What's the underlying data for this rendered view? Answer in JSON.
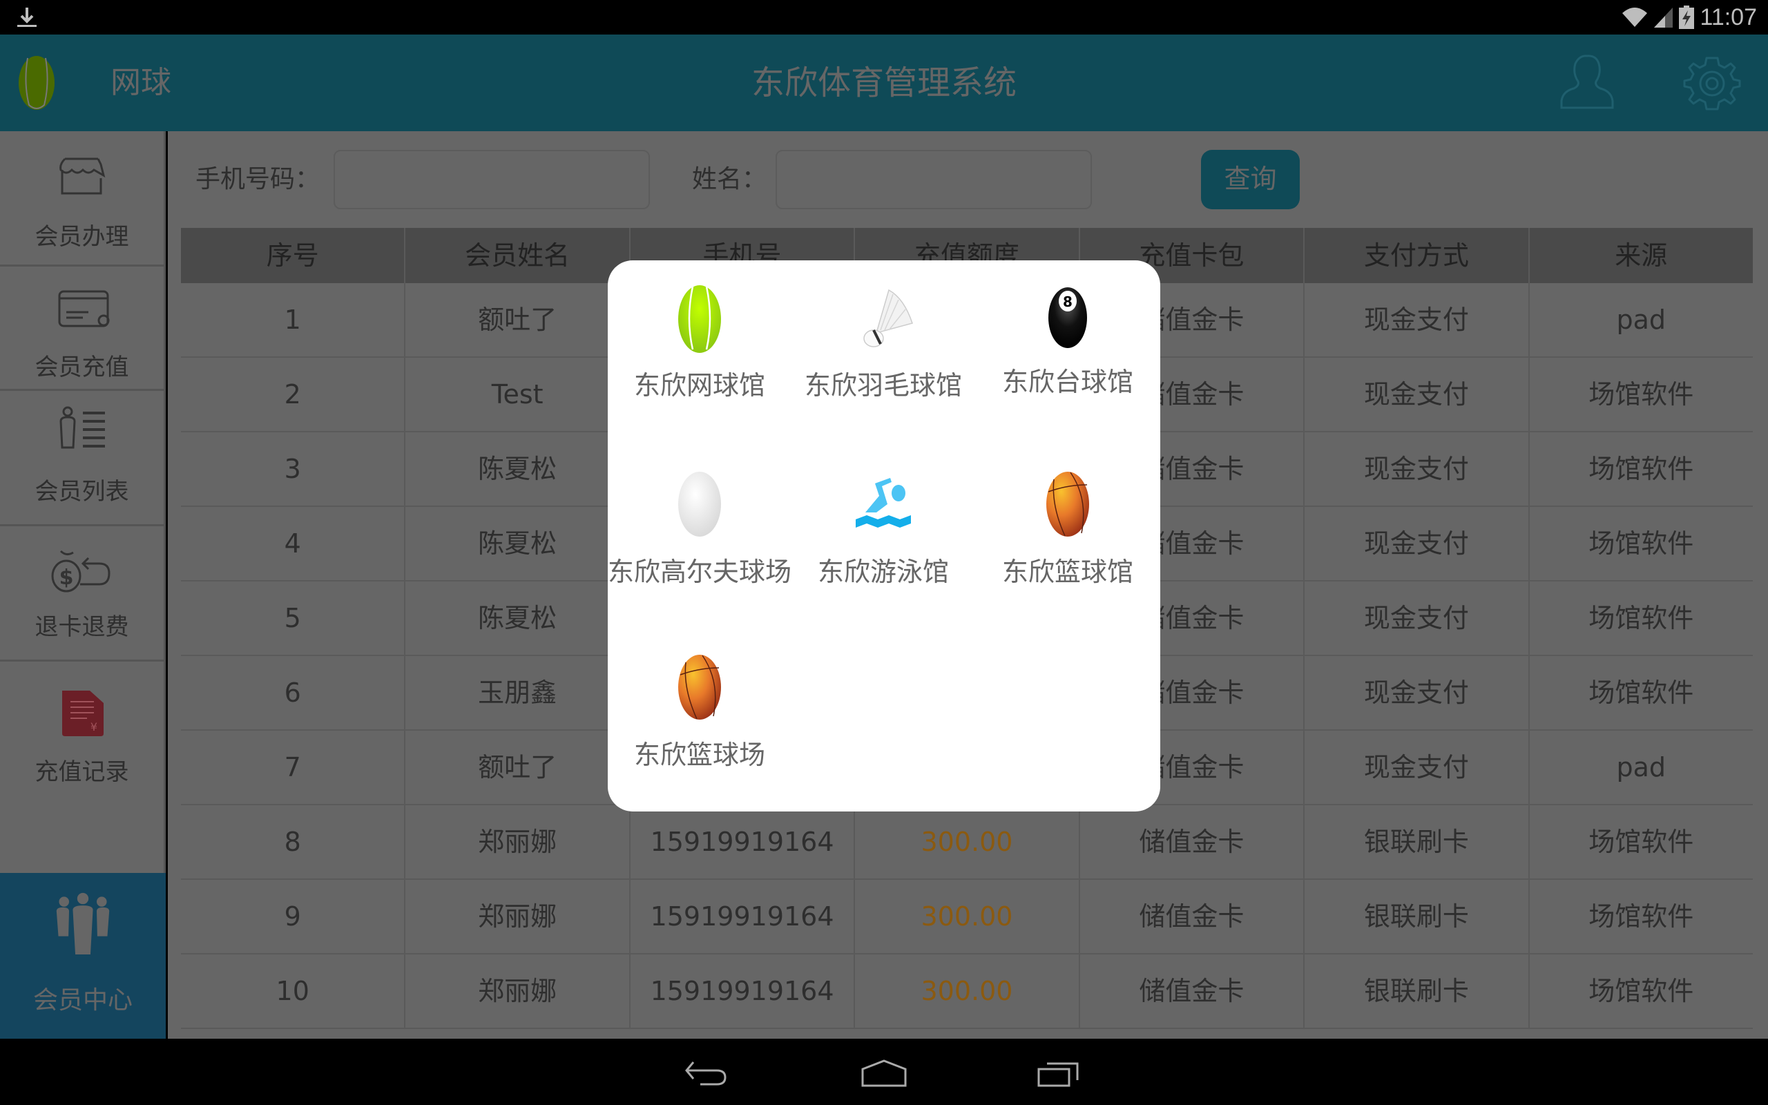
{
  "status_bar": {
    "time": "11:07",
    "icons": [
      "download-icon",
      "wifi-icon",
      "signal-icon",
      "battery-charging-icon"
    ]
  },
  "header": {
    "logo_icon": "tennis-ball-icon",
    "sport": "网球",
    "title": "东欣体育管理系统",
    "user_icon": "user-icon",
    "settings_icon": "gear-icon",
    "accent_color": "#25b9d9"
  },
  "sidebar": {
    "items": [
      {
        "label": "会员办理",
        "icon": "store-icon"
      },
      {
        "label": "会员充值",
        "icon": "card-add-icon"
      },
      {
        "label": "会员列表",
        "icon": "member-list-icon"
      },
      {
        "label": "退卡退费",
        "icon": "refund-bag-icon"
      },
      {
        "label": "充值记录",
        "icon": "recharge-record-icon"
      }
    ],
    "active": {
      "label": "会员中心",
      "icon": "members-group-icon"
    }
  },
  "search": {
    "phone_label": "手机号码：",
    "phone_value": "",
    "name_label": "姓名：",
    "name_value": "",
    "query_button": "查询"
  },
  "table": {
    "columns": [
      "序号",
      "会员姓名",
      "手机号",
      "充值额度",
      "充值卡包",
      "支付方式",
      "来源"
    ],
    "rows": [
      [
        "1",
        "额吐了",
        "",
        "",
        "储值金卡",
        "现金支付",
        "pad"
      ],
      [
        "2",
        "Test",
        "",
        "",
        "储值金卡",
        "现金支付",
        "场馆软件"
      ],
      [
        "3",
        "陈夏松",
        "",
        "",
        "储值金卡",
        "现金支付",
        "场馆软件"
      ],
      [
        "4",
        "陈夏松",
        "",
        "",
        "储值金卡",
        "现金支付",
        "场馆软件"
      ],
      [
        "5",
        "陈夏松",
        "",
        "",
        "储值金卡",
        "现金支付",
        "场馆软件"
      ],
      [
        "6",
        "玉朋鑫",
        "",
        "",
        "储值金卡",
        "现金支付",
        "场馆软件"
      ],
      [
        "7",
        "额吐了",
        "",
        "",
        "储值金卡",
        "现金支付",
        "pad"
      ],
      [
        "8",
        "郑丽娜",
        "15919919164",
        "300.00",
        "储值金卡",
        "银联刷卡",
        "场馆软件"
      ],
      [
        "9",
        "郑丽娜",
        "15919919164",
        "300.00",
        "储值金卡",
        "银联刷卡",
        "场馆软件"
      ],
      [
        "10",
        "郑丽娜",
        "15919919164",
        "300.00",
        "储值金卡",
        "银联刷卡",
        "场馆软件"
      ]
    ],
    "amount_color": "#e8961f"
  },
  "venue_dialog": {
    "venues": [
      {
        "label": "东欣网球馆",
        "icon": "tennis-ball-icon"
      },
      {
        "label": "东欣羽毛球馆",
        "icon": "shuttlecock-icon"
      },
      {
        "label": "东欣台球馆",
        "icon": "billiard-8-ball-icon"
      },
      {
        "label": "东欣高尔夫球场",
        "icon": "golf-ball-icon"
      },
      {
        "label": "东欣游泳馆",
        "icon": "swimmer-icon"
      },
      {
        "label": "东欣篮球馆",
        "icon": "basketball-icon"
      },
      {
        "label": "东欣篮球场",
        "icon": "basketball-icon"
      }
    ]
  },
  "nav_bar": {
    "buttons": [
      "back-icon",
      "home-icon",
      "recent-apps-icon"
    ]
  }
}
